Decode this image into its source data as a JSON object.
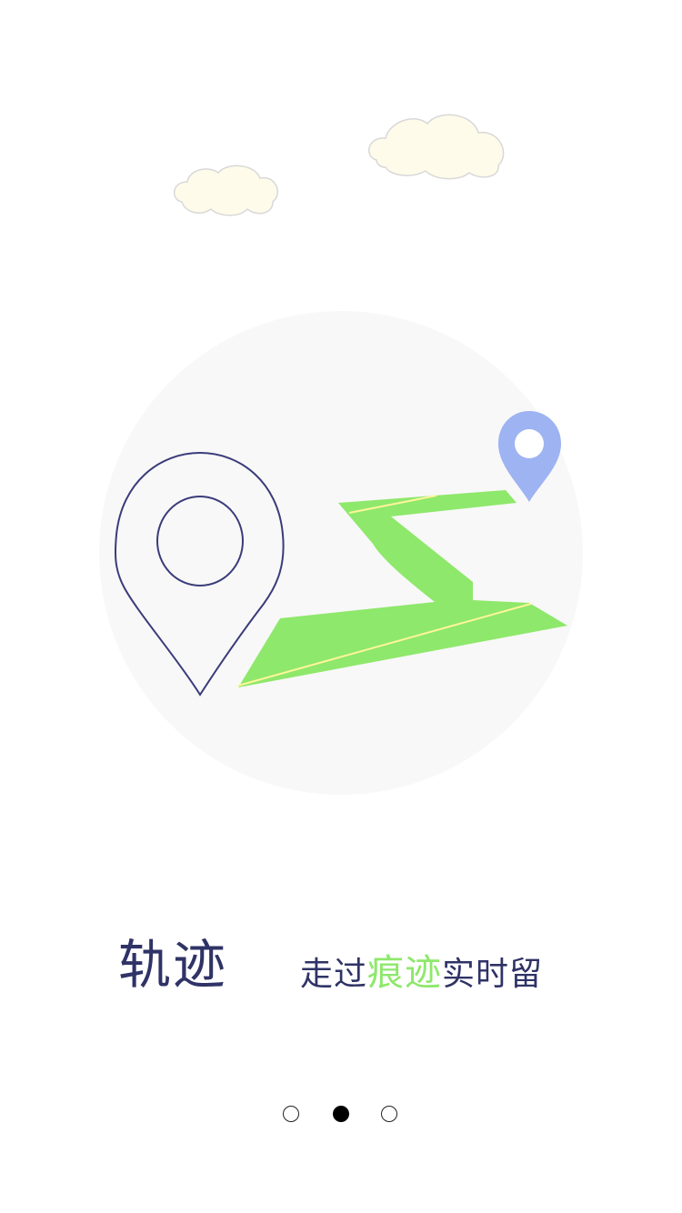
{
  "illustration": {
    "colors": {
      "circle_bg": "#f8f8f8",
      "outline_pin": "#3a3c7a",
      "route": "#8ee86b",
      "route_highlight": "#fff59a",
      "small_pin": "#9db3f2",
      "cloud_fill": "#fffbea",
      "cloud_stroke": "#d8d8d8"
    },
    "icons": [
      "cloud-icon",
      "location-pin-icon",
      "route-path-icon"
    ]
  },
  "caption": {
    "title": "轨迹",
    "slogan_prefix": "走过",
    "slogan_accent": "痕迹",
    "slogan_suffix": "实时留",
    "title_color": "#2f3366",
    "accent_color": "#8ee86b"
  },
  "pager": {
    "count": 3,
    "active_index": 1
  }
}
